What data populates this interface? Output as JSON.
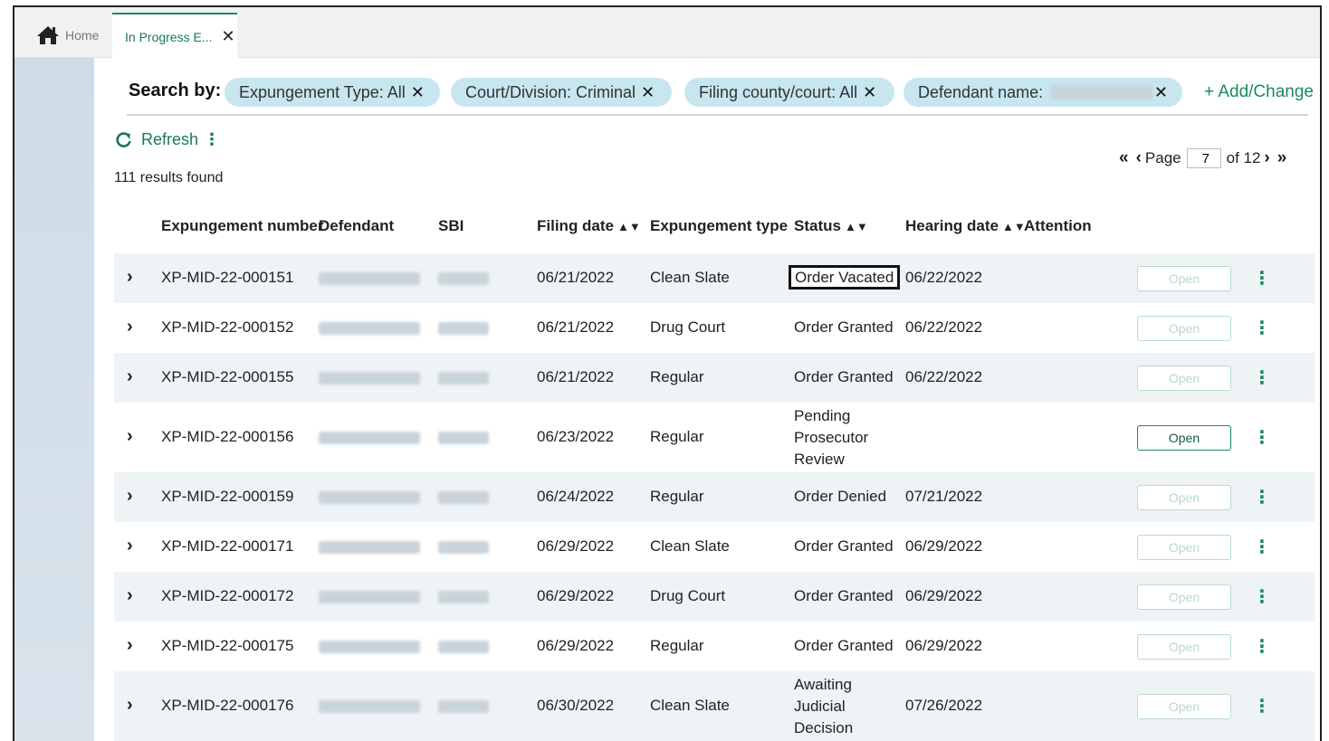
{
  "tabs": {
    "home": "Home",
    "current": "In Progress E...",
    "close": "✕"
  },
  "search": {
    "label": "Search by:",
    "chips": {
      "type": "Expungement Type: All",
      "court": "Court/Division: Criminal",
      "county": "Filing county/court: All",
      "defendant": "Defendant name:"
    },
    "remove_icon": "✕",
    "add_change": "Add/Change"
  },
  "toolbar": {
    "refresh": "Refresh"
  },
  "results": "111 results found",
  "pager": {
    "page_label": "Page",
    "page_value": "7",
    "of_label": "of 12"
  },
  "table": {
    "columns": [
      "Expungement number",
      "Defendant",
      "SBI",
      "Filing date",
      "Expungement type",
      "Status",
      "Hearing date",
      "Attention"
    ],
    "open_label": "Open",
    "rows": [
      {
        "number": "XP-MID-22-000151",
        "filing": "06/21/2022",
        "type": "Clean Slate",
        "status": "Order Vacated",
        "hearing": "06/22/2022"
      },
      {
        "number": "XP-MID-22-000152",
        "filing": "06/21/2022",
        "type": "Drug Court",
        "status": "Order Granted",
        "hearing": "06/22/2022"
      },
      {
        "number": "XP-MID-22-000155",
        "filing": "06/21/2022",
        "type": "Regular",
        "status": "Order Granted",
        "hearing": "06/22/2022"
      },
      {
        "number": "XP-MID-22-000156",
        "filing": "06/23/2022",
        "type": "Regular",
        "status": "Pending Prosecutor Review",
        "hearing": ""
      },
      {
        "number": "XP-MID-22-000159",
        "filing": "06/24/2022",
        "type": "Regular",
        "status": "Order Denied",
        "hearing": "07/21/2022"
      },
      {
        "number": "XP-MID-22-000171",
        "filing": "06/29/2022",
        "type": "Clean Slate",
        "status": "Order Granted",
        "hearing": "06/29/2022"
      },
      {
        "number": "XP-MID-22-000172",
        "filing": "06/29/2022",
        "type": "Drug Court",
        "status": "Order Granted",
        "hearing": "06/29/2022"
      },
      {
        "number": "XP-MID-22-000175",
        "filing": "06/29/2022",
        "type": "Regular",
        "status": "Order Granted",
        "hearing": "06/29/2022"
      },
      {
        "number": "XP-MID-22-000176",
        "filing": "06/30/2022",
        "type": "Clean Slate",
        "status": "Awaiting Judicial Decision",
        "hearing": "07/26/2022"
      }
    ]
  },
  "colors": {
    "accent": "#1a8a5a",
    "chip": "#c7e6ef",
    "row_shade": "#eef3f6",
    "sidebar": "#d3dfe8"
  }
}
